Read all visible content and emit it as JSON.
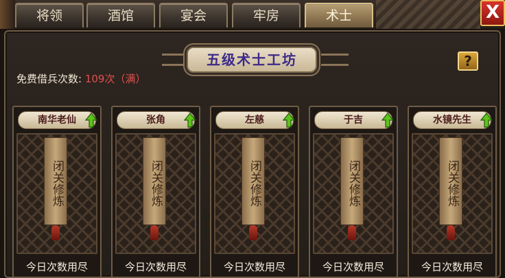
{
  "tabs": [
    {
      "label": "将领",
      "active": false
    },
    {
      "label": "酒馆",
      "active": false
    },
    {
      "label": "宴会",
      "active": false
    },
    {
      "label": "牢房",
      "active": false
    },
    {
      "label": "术士",
      "active": true
    }
  ],
  "close_label": "X",
  "panel": {
    "title": "五级术士工坊",
    "help_label": "?",
    "free_count_label": "免费借兵次数:",
    "free_count_value": "109次（满）"
  },
  "cards": [
    {
      "name": "南华老仙",
      "scroll_text": "闭关修炼",
      "status": "今日次数用尽"
    },
    {
      "name": "张角",
      "scroll_text": "闭关修炼",
      "status": "今日次数用尽"
    },
    {
      "name": "左慈",
      "scroll_text": "闭关修炼",
      "status": "今日次数用尽"
    },
    {
      "name": "于吉",
      "scroll_text": "闭关修炼",
      "status": "今日次数用尽"
    },
    {
      "name": "水镜先生",
      "scroll_text": "闭关修炼",
      "status": "今日次数用尽"
    }
  ],
  "colors": {
    "title_text": "#3c2a88",
    "free_count_value": "#e05050",
    "upgrade_arrow": "#5fc21c",
    "close_button": "#d8342a"
  },
  "icons": {
    "upgrade": "up-arrow-icon",
    "help": "question-mark-icon",
    "close": "close-icon"
  }
}
